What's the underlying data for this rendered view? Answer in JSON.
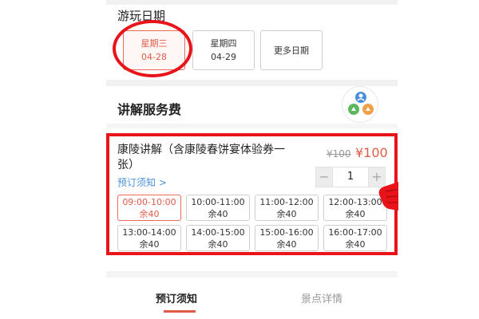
{
  "date_section": {
    "title": "游玩日期",
    "options": [
      {
        "weekday": "星期三",
        "date": "04-28",
        "selected": true
      },
      {
        "weekday": "星期四",
        "date": "04-29",
        "selected": false
      }
    ],
    "more_label": "更多日期"
  },
  "fee_section": {
    "title": "讲解服务费",
    "icon": "service-logo-icon"
  },
  "item": {
    "name": "康陵讲解（含康陵春饼宴体验券一张）",
    "old_price": "¥100",
    "new_price": "¥100",
    "notice_link": "预订须知 >",
    "quantity": "1",
    "minus": "−",
    "plus": "+"
  },
  "slots": [
    {
      "time": "09:00-10:00",
      "remain": "余40",
      "selected": true
    },
    {
      "time": "10:00-11:00",
      "remain": "余40",
      "selected": false
    },
    {
      "time": "11:00-12:00",
      "remain": "余40",
      "selected": false
    },
    {
      "time": "12:00-13:00",
      "remain": "余40",
      "selected": false
    },
    {
      "time": "13:00-14:00",
      "remain": "余40",
      "selected": false
    },
    {
      "time": "14:00-15:00",
      "remain": "余40",
      "selected": false
    },
    {
      "time": "15:00-16:00",
      "remain": "余40",
      "selected": false
    },
    {
      "time": "16:00-17:00",
      "remain": "余40",
      "selected": false
    }
  ],
  "tabs": [
    {
      "label": "预订须知",
      "active": true
    },
    {
      "label": "景点详情",
      "active": false
    }
  ],
  "colors": {
    "accent": "#e05a48",
    "annotation": "#e8141a",
    "link": "#4a90d9"
  }
}
